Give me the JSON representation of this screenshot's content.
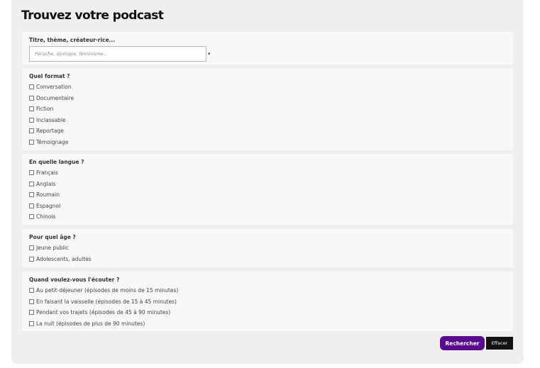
{
  "title": "Trouvez votre podcast",
  "search": {
    "label": "Titre, thème, créateur·rice...",
    "placeholder": "Péroche, dystopie, féminisme...",
    "caret": "▾"
  },
  "sections": [
    {
      "label": "Quel format ?",
      "options": [
        "Conversation",
        "Documentaire",
        "Fiction",
        "Inclassable",
        "Reportage",
        "Témoignage"
      ]
    },
    {
      "label": "En quelle langue ?",
      "options": [
        "Français",
        "Anglais",
        "Roumain",
        "Espagnol",
        "Chinois"
      ]
    },
    {
      "label": "Pour quel âge ?",
      "options": [
        "Jeune public",
        "Adolescents, adultes"
      ]
    },
    {
      "label": "Quand voulez-vous l'écouter ?",
      "options": [
        "Au petit-déjeuner (épisodes de moins de 15 minutes)",
        "En faisant la vaisselle (épisodes de 15 à 45 minutes)",
        "Pendant vos trajets (épisodes de 45 à 90 minutes)",
        "La nuit (épisodes de plus de 90 minutes)"
      ]
    }
  ],
  "buttons": {
    "search_label": "Rechercher",
    "clear_label": "Effacer"
  },
  "colors": {
    "accent": "#5a0a8e",
    "clear_button": "#111111",
    "panel": "#efefef",
    "section": "#f8f8f8"
  }
}
